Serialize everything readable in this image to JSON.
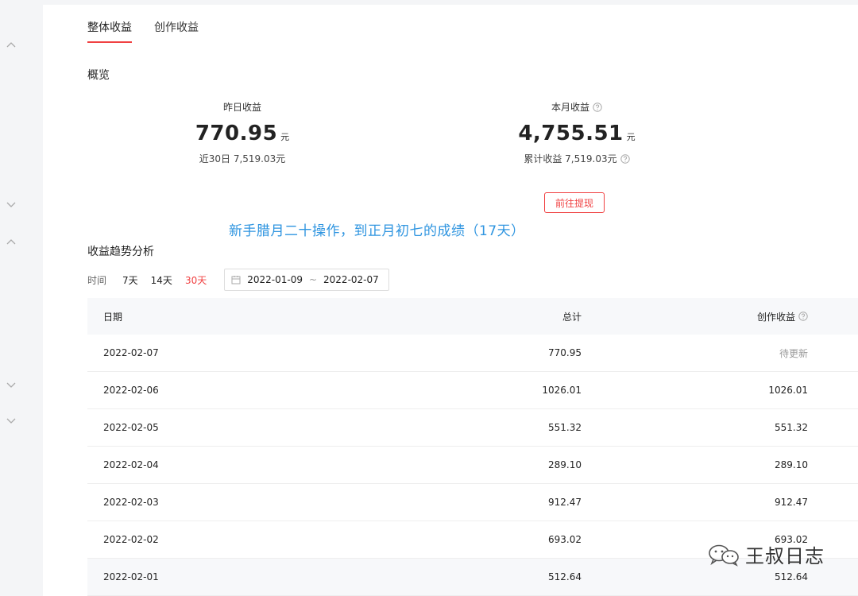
{
  "tabs": [
    {
      "label": "整体收益",
      "active": true
    },
    {
      "label": "创作收益",
      "active": false
    }
  ],
  "overview": {
    "title": "概览",
    "yesterday": {
      "label": "昨日收益",
      "value": "770.95",
      "unit": "元",
      "sub": "近30日 7,519.03元"
    },
    "month": {
      "label": "本月收益",
      "value": "4,755.51",
      "unit": "元",
      "sub": "累计收益 7,519.03元"
    },
    "withdraw_label": "前往提现"
  },
  "caption": "新手腊月二十操作，到正月初七的成绩（17天）",
  "trend": {
    "title": "收益趋势分析",
    "filter_label": "时间",
    "ranges": [
      {
        "label": "7天",
        "active": false
      },
      {
        "label": "14天",
        "active": false
      },
      {
        "label": "30天",
        "active": true
      }
    ],
    "date_start": "2022-01-09",
    "date_sep": "~",
    "date_end": "2022-02-07"
  },
  "table": {
    "headers": {
      "date": "日期",
      "total": "总计",
      "creation": "创作收益"
    },
    "rows": [
      {
        "date": "2022-02-07",
        "total": "770.95",
        "creation": "待更新"
      },
      {
        "date": "2022-02-06",
        "total": "1026.01",
        "creation": "1026.01"
      },
      {
        "date": "2022-02-05",
        "total": "551.32",
        "creation": "551.32"
      },
      {
        "date": "2022-02-04",
        "total": "289.10",
        "creation": "289.10"
      },
      {
        "date": "2022-02-03",
        "total": "912.47",
        "creation": "912.47"
      },
      {
        "date": "2022-02-02",
        "total": "693.02",
        "creation": "693.02"
      },
      {
        "date": "2022-02-01",
        "total": "512.64",
        "creation": "512.64"
      }
    ]
  },
  "watermark": {
    "text": "王叔日志"
  },
  "colors": {
    "accent": "#f04142",
    "caption": "#2f95e0"
  }
}
